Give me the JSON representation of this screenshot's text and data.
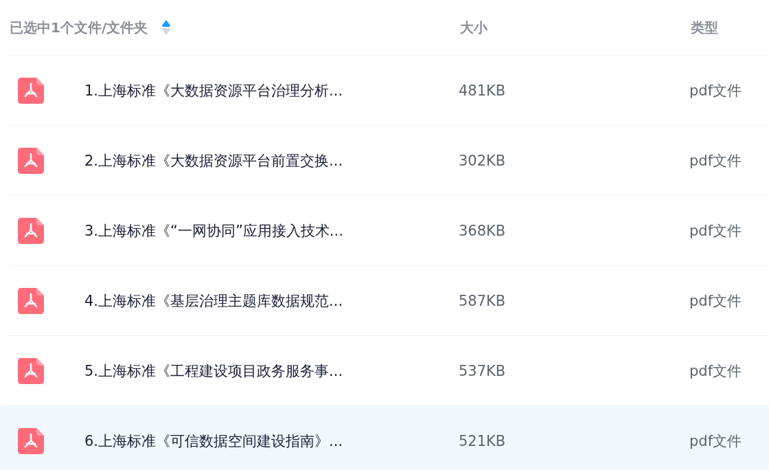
{
  "table": {
    "columns": [
      {
        "label": "已选中1个文件/文件夹",
        "sort_ascending": true
      },
      {
        "label": "大小"
      },
      {
        "label": "类型"
      }
    ],
    "rows": [
      {
        "name": "1.上海标准《大数据资源平台治理分析...",
        "size": "481KB",
        "type": "pdf文件",
        "selected": false
      },
      {
        "name": "2.上海标准《大数据资源平台前置交换...",
        "size": "302KB",
        "type": "pdf文件",
        "selected": false
      },
      {
        "name": "3.上海标准《“一网协同”应用接入技术...",
        "size": "368KB",
        "type": "pdf文件",
        "selected": false
      },
      {
        "name": "4.上海标准《基层治理主题库数据规范...",
        "size": "587KB",
        "type": "pdf文件",
        "selected": false
      },
      {
        "name": "5.上海标准《工程建设项目政务服务事...",
        "size": "537KB",
        "type": "pdf文件",
        "selected": false
      },
      {
        "name": "6.上海标准《可信数据空间建设指南》...",
        "size": "521KB",
        "type": "pdf文件",
        "selected": true
      }
    ]
  }
}
